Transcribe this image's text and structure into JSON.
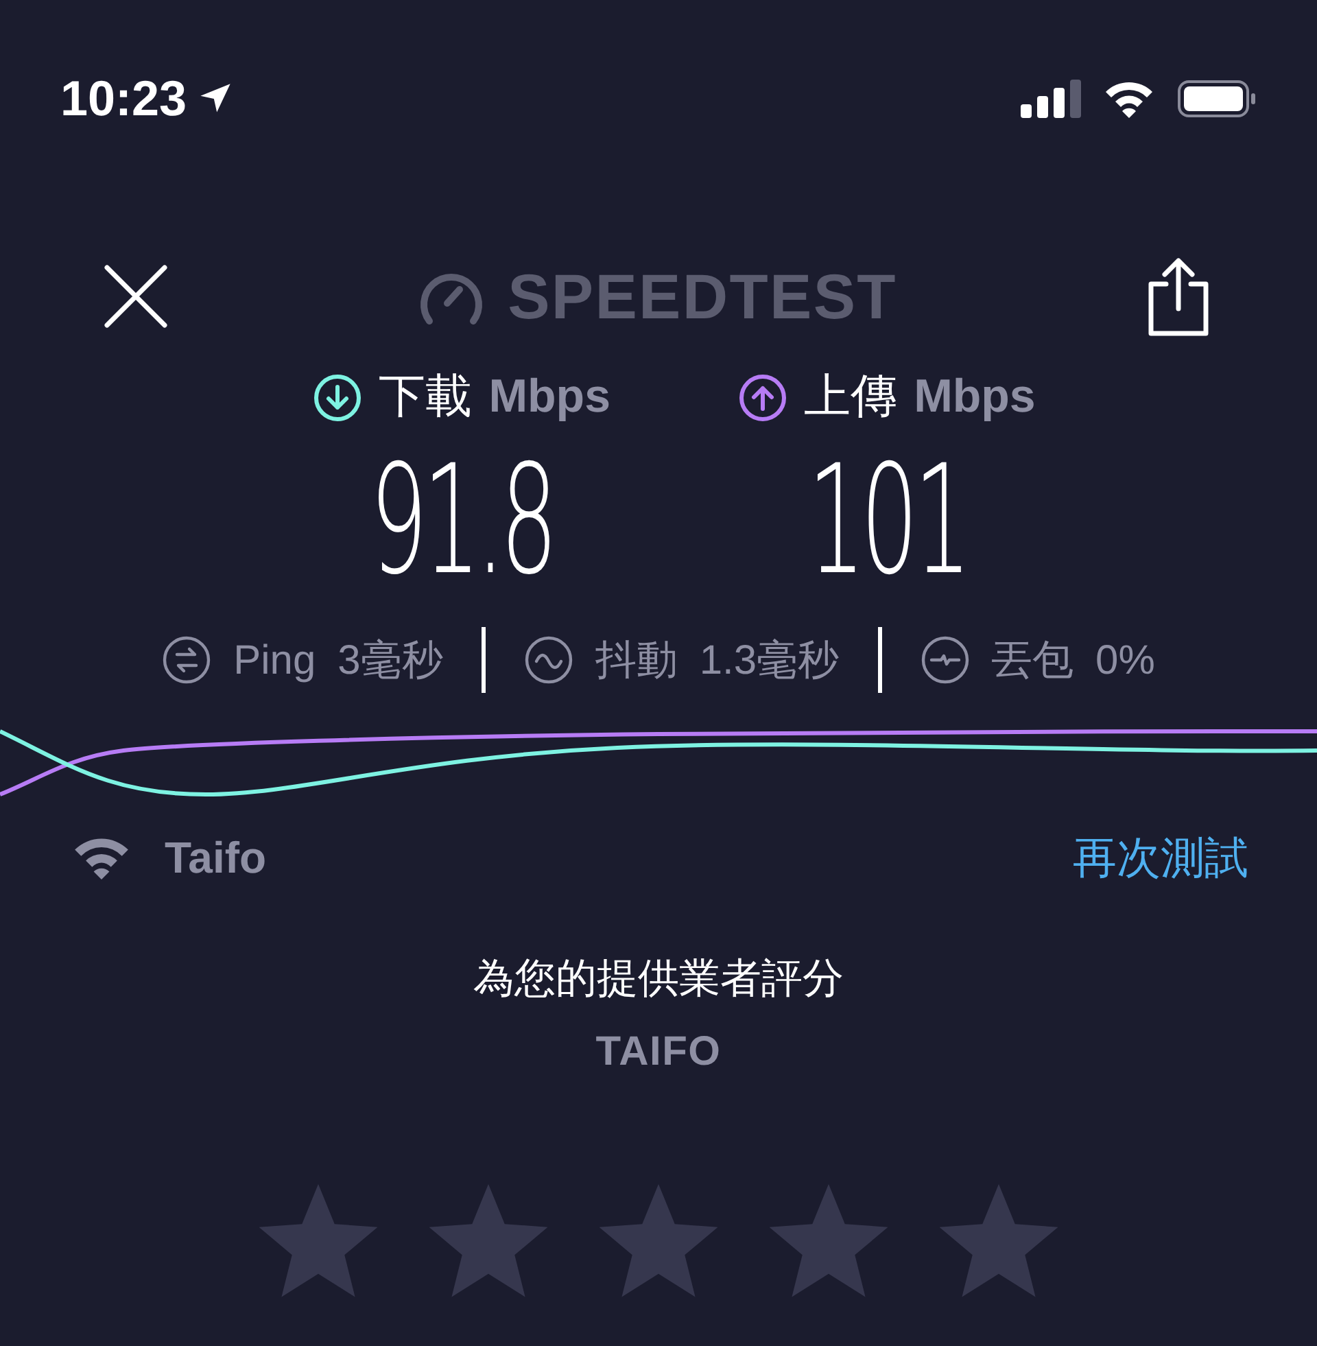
{
  "status_bar": {
    "time": "10:23"
  },
  "header": {
    "logo": "SPEEDTEST"
  },
  "results": [
    {
      "kind": "download",
      "label": "下載",
      "unit": "Mbps",
      "value": "91.8"
    },
    {
      "kind": "upload",
      "label": "上傳",
      "unit": "Mbps",
      "value": "101"
    }
  ],
  "metrics": [
    {
      "kind": "ping",
      "label": "Ping",
      "value": "3毫秒"
    },
    {
      "kind": "jitter",
      "label": "抖動",
      "value": "1.3毫秒"
    },
    {
      "kind": "loss",
      "label": "丟包",
      "value": "0%"
    }
  ],
  "network": {
    "name": "Taifo",
    "retest": "再次測試"
  },
  "rating": {
    "prompt": "為您的提供業者評分",
    "provider": "TAIFO"
  }
}
